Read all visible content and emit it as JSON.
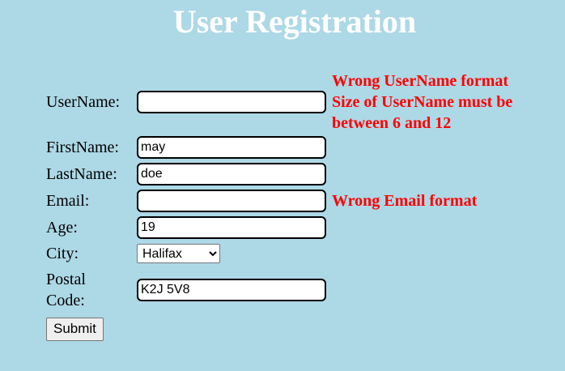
{
  "page": {
    "title": "User Registration"
  },
  "form": {
    "username": {
      "label": "UserName:",
      "value": "",
      "errors": [
        "Wrong UserName format",
        "Size of UserName must be between 6 and 12"
      ]
    },
    "firstname": {
      "label": "FirstName:",
      "value": "may"
    },
    "lastname": {
      "label": "LastName:",
      "value": "doe"
    },
    "email": {
      "label": "Email:",
      "value": "",
      "error": "Wrong Email format"
    },
    "age": {
      "label": "Age:",
      "value": "19"
    },
    "city": {
      "label": "City:",
      "selected": "Halifax"
    },
    "postal": {
      "label": "Postal Code:",
      "value": "K2J 5V8"
    },
    "submit_label": "Submit"
  },
  "colors": {
    "background": "#add8e6",
    "title": "#ffffff",
    "error": "#ff0000"
  }
}
